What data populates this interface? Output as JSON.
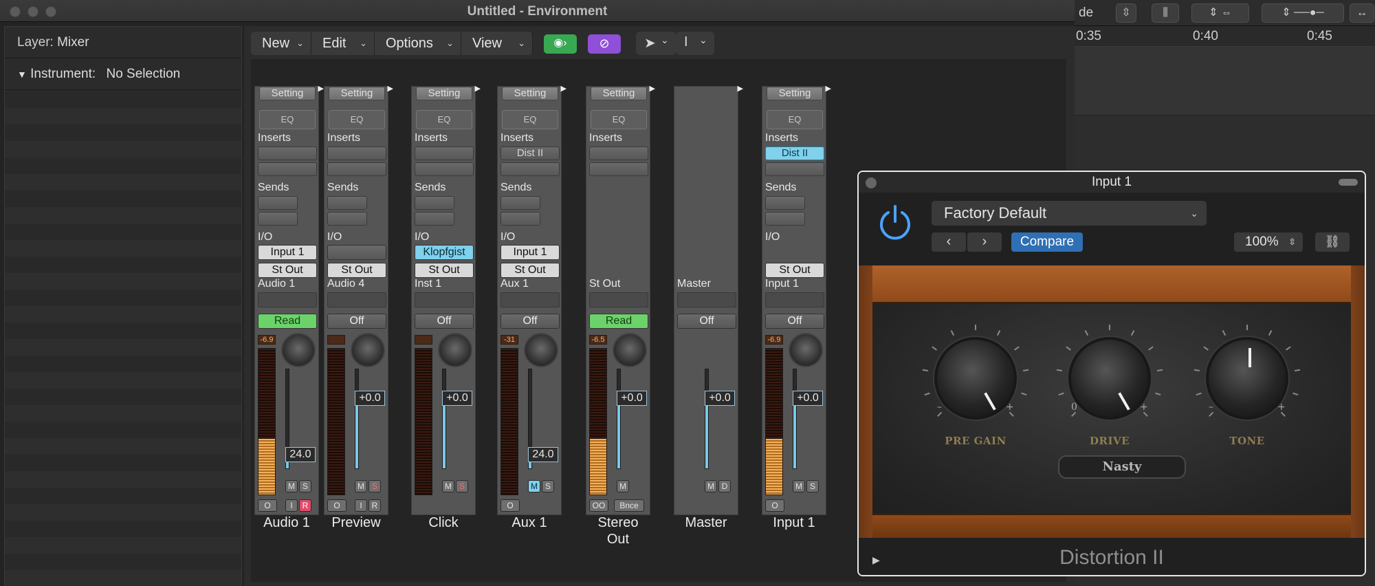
{
  "window": {
    "title": "Untitled - Environment"
  },
  "right_toolbar": {
    "mode_text": "de",
    "ruler": [
      "0:35",
      "0:40",
      "0:45"
    ]
  },
  "inspector": {
    "layer_label": "Layer:",
    "layer_value": "Mixer",
    "instrument_label": "Instrument:",
    "instrument_value": "No Selection"
  },
  "toolbar": {
    "menus": [
      "New",
      "Edit",
      "Options",
      "View"
    ]
  },
  "strips": [
    {
      "setting": "Setting",
      "eq": "EQ",
      "inserts_label": "Inserts",
      "insert1": "",
      "sends_label": "Sends",
      "io_label": "I/O",
      "input": "Input 1",
      "output": "St Out",
      "track": "Audio 1",
      "automation": "Read",
      "peak": "-6.9",
      "volume": "24.0",
      "name": "Audio 1",
      "meter_level": 0.38,
      "fader_level": 0.13
    },
    {
      "setting": "Setting",
      "eq": "EQ",
      "inserts_label": "Inserts",
      "insert1": "",
      "sends_label": "Sends",
      "io_label": "I/O",
      "input": "",
      "output": "St Out",
      "track": "Audio 4",
      "automation": "Off",
      "peak": "",
      "volume": "+0.0",
      "name": "Preview",
      "meter_level": 0,
      "fader_level": 0.75
    },
    {
      "setting": "Setting",
      "eq": "EQ",
      "inserts_label": "Inserts",
      "insert1": "",
      "sends_label": "Sends",
      "io_label": "I/O",
      "input": "Klopfgist",
      "output": "St Out",
      "track": "Inst 1",
      "automation": "Off",
      "peak": "",
      "volume": "+0.0",
      "name": "Click",
      "meter_level": 0,
      "fader_level": 0.75
    },
    {
      "setting": "Setting",
      "eq": "EQ",
      "inserts_label": "Inserts",
      "insert1": "Dist II",
      "sends_label": "Sends",
      "io_label": "I/O",
      "input": "Input 1",
      "output": "St Out",
      "track": "Aux 1",
      "automation": "Off",
      "peak": "-31",
      "volume": "24.0",
      "name": "Aux 1",
      "meter_level": 0,
      "fader_level": 0.13
    },
    {
      "setting": "Setting",
      "eq": "EQ",
      "inserts_label": "Inserts",
      "insert1": "",
      "sends_label": "",
      "io_label": "",
      "input": "",
      "output": "",
      "track": "St Out",
      "automation": "Read",
      "peak": "-6.5",
      "volume": "+0.0",
      "name": "Stereo Out",
      "meter_level": 0.38,
      "fader_level": 0.75
    },
    {
      "setting": "",
      "eq": "",
      "inserts_label": "",
      "insert1": "",
      "sends_label": "",
      "io_label": "",
      "input": "",
      "output": "",
      "track": "Master",
      "automation": "Off",
      "peak": "",
      "volume": "+0.0",
      "name": "Master",
      "meter_level": 0,
      "fader_level": 0.75
    },
    {
      "setting": "Setting",
      "eq": "EQ",
      "inserts_label": "Inserts",
      "insert1": "Dist II",
      "sends_label": "Sends",
      "io_label": "I/O",
      "input": "",
      "output": "St Out",
      "track": "Input 1",
      "automation": "Off",
      "peak": "-6.9",
      "volume": "+0.0",
      "name": "Input 1",
      "meter_level": 0.38,
      "fader_level": 0.75
    }
  ],
  "strip_buttons": {
    "mute": "M",
    "solo": "S",
    "input_mon": "I",
    "record": "R",
    "dim": "D",
    "bounce": "Bnce",
    "io_circle": "O",
    "link": "OO"
  },
  "plugin": {
    "title": "Input 1",
    "preset": "Factory Default",
    "compare": "Compare",
    "zoom": "100%",
    "knobs": [
      {
        "label": "PRE GAIN",
        "min": "–",
        "max": "+",
        "angle_deg": 150
      },
      {
        "label": "DRIVE",
        "min": "0",
        "max": "+",
        "angle_deg": 150
      },
      {
        "label": "TONE",
        "min": "–",
        "max": "+",
        "angle_deg": 0
      }
    ],
    "mode": "Nasty",
    "name": "Distortion II",
    "power_color": "#4aa3ff"
  }
}
